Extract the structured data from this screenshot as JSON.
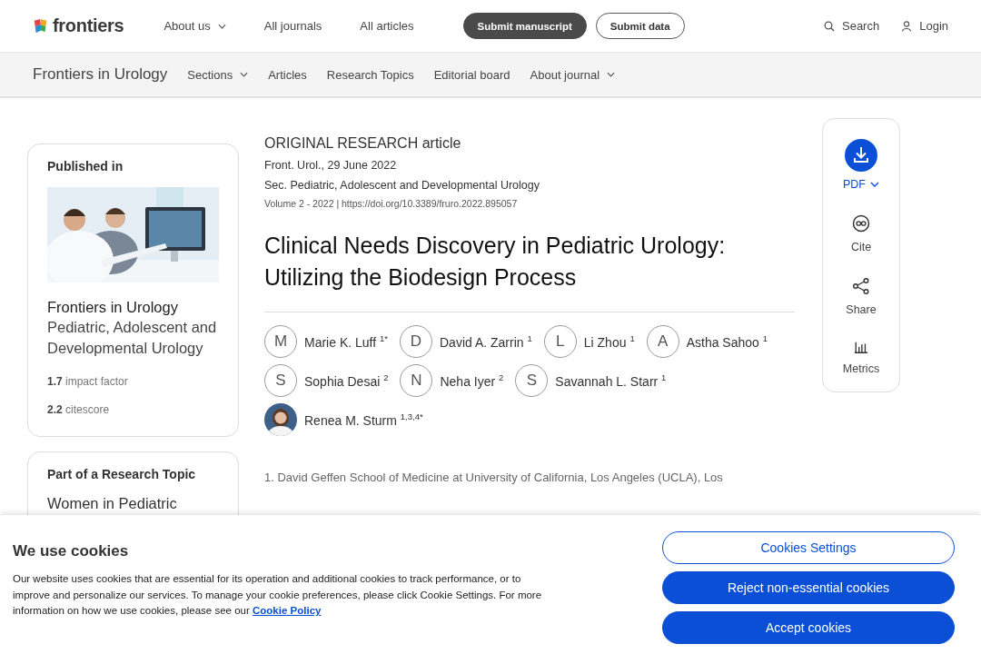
{
  "header": {
    "logo": "frontiers",
    "nav": [
      {
        "label": "About us",
        "dropdown": true
      },
      {
        "label": "All journals",
        "dropdown": false
      },
      {
        "label": "All articles",
        "dropdown": false
      }
    ],
    "buttons": [
      {
        "label": "Submit manuscript",
        "kind": "filled"
      },
      {
        "label": "Submit data",
        "kind": "outline"
      }
    ],
    "search": "Search",
    "login": "Login"
  },
  "journal_bar": {
    "title": "Frontiers in Urology",
    "nav": [
      {
        "label": "Sections",
        "dropdown": true
      },
      {
        "label": "Articles",
        "dropdown": false
      },
      {
        "label": "Research Topics",
        "dropdown": false
      },
      {
        "label": "Editorial board",
        "dropdown": false
      },
      {
        "label": "About journal",
        "dropdown": true
      }
    ]
  },
  "published_card": {
    "heading": "Published in",
    "journal": "Frontiers in Urology",
    "section": "Pediatric, Adolescent and Developmental Urology",
    "metrics": [
      {
        "value": "1.7",
        "label": "impact factor"
      },
      {
        "value": "2.2",
        "label": "citescore"
      }
    ]
  },
  "topic_card": {
    "heading": "Part of a Research Topic",
    "title": "Women in Pediatric"
  },
  "article": {
    "type": "ORIGINAL RESEARCH article",
    "date": "Front. Urol., 29 June 2022",
    "section": "Sec. Pediatric, Adolescent and Developmental Urology",
    "volume": "Volume 2 - 2022 | https://doi.org/10.3389/fruro.2022.895057",
    "title": "Clinical Needs Discovery in Pediatric Urology: Utilizing the Biodesign Process",
    "authors": [
      {
        "kind": "initial",
        "initial": "M",
        "name": "Marie K. Luff $^{1*}$"
      },
      {
        "kind": "initial",
        "initial": "D",
        "name": "David A. Zarrin $^{1}$"
      },
      {
        "kind": "initial",
        "initial": "L",
        "name": "Li Zhou $^{1}$"
      },
      {
        "kind": "initial",
        "initial": "A",
        "name": "Astha Sahoo $^{1}$"
      },
      {
        "kind": "initial",
        "initial": "S",
        "name": "Sophia Desai $^{2}$"
      },
      {
        "kind": "initial",
        "initial": "N",
        "name": "Neha Iyer $^{2}$"
      },
      {
        "kind": "initial",
        "initial": "S",
        "name": "Savannah L. Starr $^{1}$"
      },
      {
        "name": "Renea M. Sturm $^{1,3,4*}$"
      }
    ],
    "affiliation": "1. David Geffen School of Medicine at University of California, Los Angeles (UCLA), Los"
  },
  "actions": [
    {
      "kind": "pdf",
      "label": "PDF"
    },
    {
      "kind": "cite",
      "label": "Cite"
    },
    {
      "kind": "share",
      "label": "Share"
    },
    {
      "kind": "metrics",
      "label": "Metrics"
    }
  ],
  "cookie_banner": {
    "title": "We use cookies",
    "text": "Our website uses cookies that are essential for its operation and additional cookies to track performance, or to improve and personalize our services. To manage your cookie preferences, please click Cookie Settings. For more information on how we use cookies, please see our",
    "link": "Cookie Policy",
    "buttons": [
      {
        "label": "Cookies Settings",
        "kind": "outline"
      },
      {
        "label": "Reject non-essential cookies",
        "kind": "filled"
      },
      {
        "label": "Accept cookies",
        "kind": "filled"
      }
    ]
  }
}
